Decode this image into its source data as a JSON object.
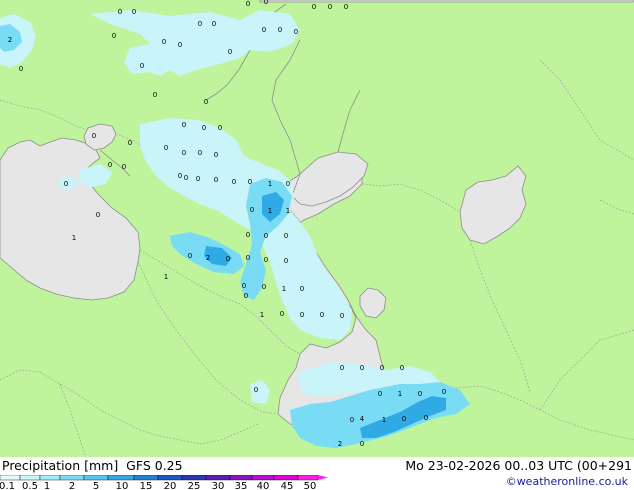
{
  "header": {
    "product": "Precipitation [mm]",
    "model": "GFS 0.25",
    "valid_time": "Mo 23-02-2026 00..03 UTC (00+291",
    "credit": "©weatheronline.co.uk"
  },
  "legend": {
    "ticks": [
      "0.1",
      "0.5",
      "1",
      "2",
      "5",
      "10",
      "15",
      "20",
      "25",
      "30",
      "35",
      "40",
      "45",
      "50"
    ],
    "colors": [
      "#e6fafa",
      "#c8f4fa",
      "#a0ecf8",
      "#7adcf4",
      "#52c8ee",
      "#30aae4",
      "#1e82d4",
      "#1a5ac8",
      "#2838b4",
      "#5a1eb4",
      "#8a14c4",
      "#b80cd0",
      "#e000d8",
      "#ff20e8"
    ]
  },
  "colors": {
    "land": "#c0f49c",
    "sea": "#e6e6e6",
    "rain_light": "#c8f4fa",
    "rain_medium": "#7adcf4",
    "rain_heavy": "#30aae4"
  },
  "map_values": [
    {
      "id": "v1",
      "text": "2"
    },
    {
      "id": "v2",
      "text": "0"
    },
    {
      "id": "v3",
      "text": "0"
    },
    {
      "id": "v4",
      "text": "0"
    },
    {
      "id": "v5",
      "text": "0"
    },
    {
      "id": "v6",
      "text": "0"
    },
    {
      "id": "v7",
      "text": "0"
    },
    {
      "id": "v8",
      "text": "0"
    },
    {
      "id": "v9",
      "text": "0"
    },
    {
      "id": "v10",
      "text": "0"
    },
    {
      "id": "v11",
      "text": "0"
    },
    {
      "id": "v12",
      "text": "0"
    },
    {
      "id": "v13",
      "text": "0"
    },
    {
      "id": "v14",
      "text": "0"
    },
    {
      "id": "v15",
      "text": "0"
    },
    {
      "id": "v16",
      "text": "0"
    },
    {
      "id": "v17",
      "text": "0"
    },
    {
      "id": "v18",
      "text": "0"
    },
    {
      "id": "v19",
      "text": "0"
    },
    {
      "id": "v20",
      "text": "0"
    },
    {
      "id": "v21",
      "text": "0"
    },
    {
      "id": "v22",
      "text": "0"
    },
    {
      "id": "v23",
      "text": "0"
    },
    {
      "id": "v24",
      "text": "0"
    },
    {
      "id": "v25",
      "text": "0"
    },
    {
      "id": "v26",
      "text": "0"
    },
    {
      "id": "v27",
      "text": "0"
    },
    {
      "id": "v28",
      "text": "0"
    },
    {
      "id": "v29",
      "text": "0"
    },
    {
      "id": "v30",
      "text": "0"
    },
    {
      "id": "v31",
      "text": "0"
    },
    {
      "id": "v32",
      "text": "0"
    },
    {
      "id": "v33",
      "text": "0"
    },
    {
      "id": "v34",
      "text": "0"
    },
    {
      "id": "v35",
      "text": "0"
    },
    {
      "id": "v36",
      "text": "1"
    },
    {
      "id": "v37",
      "text": "0"
    },
    {
      "id": "v38",
      "text": "0"
    },
    {
      "id": "v39",
      "text": "0"
    },
    {
      "id": "v40",
      "text": "1"
    },
    {
      "id": "v41",
      "text": "1"
    },
    {
      "id": "v42",
      "text": "0"
    },
    {
      "id": "v43",
      "text": "0"
    },
    {
      "id": "v44",
      "text": "0"
    },
    {
      "id": "v45",
      "text": "0"
    },
    {
      "id": "v46",
      "text": "0"
    },
    {
      "id": "v47",
      "text": "1"
    },
    {
      "id": "v48",
      "text": "2"
    },
    {
      "id": "v49",
      "text": "0"
    },
    {
      "id": "v50",
      "text": "0"
    },
    {
      "id": "v51",
      "text": "0"
    },
    {
      "id": "v52",
      "text": "0"
    },
    {
      "id": "v53",
      "text": "0"
    },
    {
      "id": "v54",
      "text": "1"
    },
    {
      "id": "v55",
      "text": "0"
    },
    {
      "id": "v56",
      "text": "0"
    },
    {
      "id": "v57",
      "text": "1"
    },
    {
      "id": "v58",
      "text": "0"
    },
    {
      "id": "v59",
      "text": "0"
    },
    {
      "id": "v60",
      "text": "0"
    },
    {
      "id": "v61",
      "text": "0"
    },
    {
      "id": "v62",
      "text": "0"
    },
    {
      "id": "v63",
      "text": "0"
    },
    {
      "id": "v64",
      "text": "0"
    },
    {
      "id": "v65",
      "text": "0"
    },
    {
      "id": "v66",
      "text": "0"
    },
    {
      "id": "v67",
      "text": "0"
    },
    {
      "id": "v68",
      "text": "0"
    },
    {
      "id": "v69",
      "text": "1"
    },
    {
      "id": "v70",
      "text": "0"
    },
    {
      "id": "v71",
      "text": "0"
    },
    {
      "id": "v72",
      "text": "1"
    },
    {
      "id": "v73",
      "text": "0"
    },
    {
      "id": "v74",
      "text": "4"
    },
    {
      "id": "v75",
      "text": "0"
    },
    {
      "id": "v76",
      "text": "1"
    },
    {
      "id": "v77",
      "text": "2"
    },
    {
      "id": "v78",
      "text": "0"
    },
    {
      "id": "v79",
      "text": "0"
    },
    {
      "id": "v80",
      "text": "0"
    },
    {
      "id": "v81",
      "text": "0"
    },
    {
      "id": "v82",
      "text": "0"
    }
  ]
}
